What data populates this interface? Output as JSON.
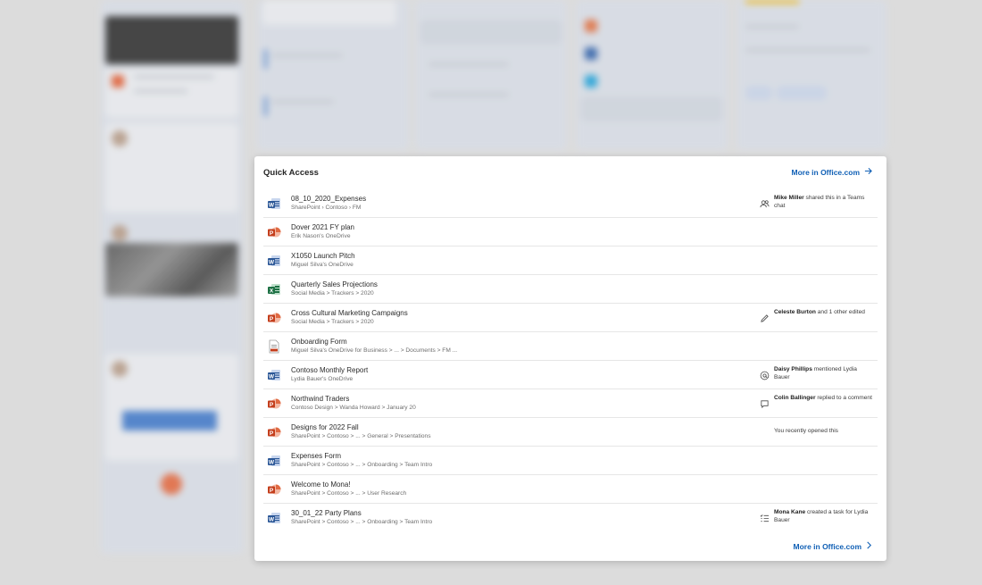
{
  "quick_access": {
    "title": "Quick Access",
    "more_link_top": "More in Office.com",
    "more_link_bottom": "More in Office.com",
    "files": [
      {
        "name": "08_10_2020_Expenses",
        "path": "SharePoint › Contoso › FM",
        "type": "word",
        "activity": {
          "actor": "Mike Miller",
          "text": " shared this in a Teams chat",
          "icon": "people-icon"
        }
      },
      {
        "name": "Dover 2021 FY plan",
        "path": "Erik Nason's OneDrive",
        "type": "powerpoint",
        "activity": null
      },
      {
        "name": "X1050 Launch Pitch",
        "path": "Miguel Silva's OneDrive",
        "type": "word",
        "activity": null
      },
      {
        "name": "Quarterly Sales Projections",
        "path": "Social Media > Trackers > 2020",
        "type": "excel",
        "activity": null
      },
      {
        "name": "Cross Cultural Marketing Campaigns",
        "path": "Social Media > Trackers > 2020",
        "type": "powerpoint",
        "activity": {
          "actor": "Celeste Burton",
          "text": " and 1 other edited",
          "icon": "pencil-icon"
        }
      },
      {
        "name": "Onboarding Form",
        "path": "Miguel Silva's OneDrive for Business > ... > Documents > FM ...",
        "type": "form",
        "activity": null
      },
      {
        "name": "Contoso Monthly Report",
        "path": "Lydia Bauer's OneDrive",
        "type": "word",
        "activity": {
          "actor": "Daisy Phillips",
          "text": " mentioned Lydia Bauer",
          "icon": "mention-icon"
        }
      },
      {
        "name": "Northwind Traders",
        "path": "Contoso Design > Wanda Howard > January 20",
        "type": "powerpoint",
        "activity": {
          "actor": "Colin Ballinger",
          "text": " replied to a comment",
          "icon": "comment-icon"
        }
      },
      {
        "name": "Designs for 2022 Fall",
        "path": "SharePoint > Contoso > ... > General > Presentations",
        "type": "powerpoint",
        "activity": {
          "actor": "",
          "text": "You recently opened this",
          "icon": ""
        }
      },
      {
        "name": "Expenses Form",
        "path": "SharePoint > Contoso > ... > Onboarding > Team Intro",
        "type": "word",
        "activity": null
      },
      {
        "name": "Welcome to Mona!",
        "path": "SharePoint > Contoso > ... > User Research",
        "type": "powerpoint",
        "activity": null
      },
      {
        "name": "30_01_22 Party Plans",
        "path": "SharePoint > Contoso > ... > Onboarding > Team Intro",
        "type": "word",
        "activity": {
          "actor": "Mona Kane",
          "text": " created a task for Lydia Bauer",
          "icon": "tasklist-icon"
        }
      }
    ]
  },
  "colors": {
    "accent": "#0f5fb5",
    "word": "#2b5797",
    "powerpoint": "#c43e1c",
    "excel": "#1e7145",
    "form": "#c43e1c"
  }
}
